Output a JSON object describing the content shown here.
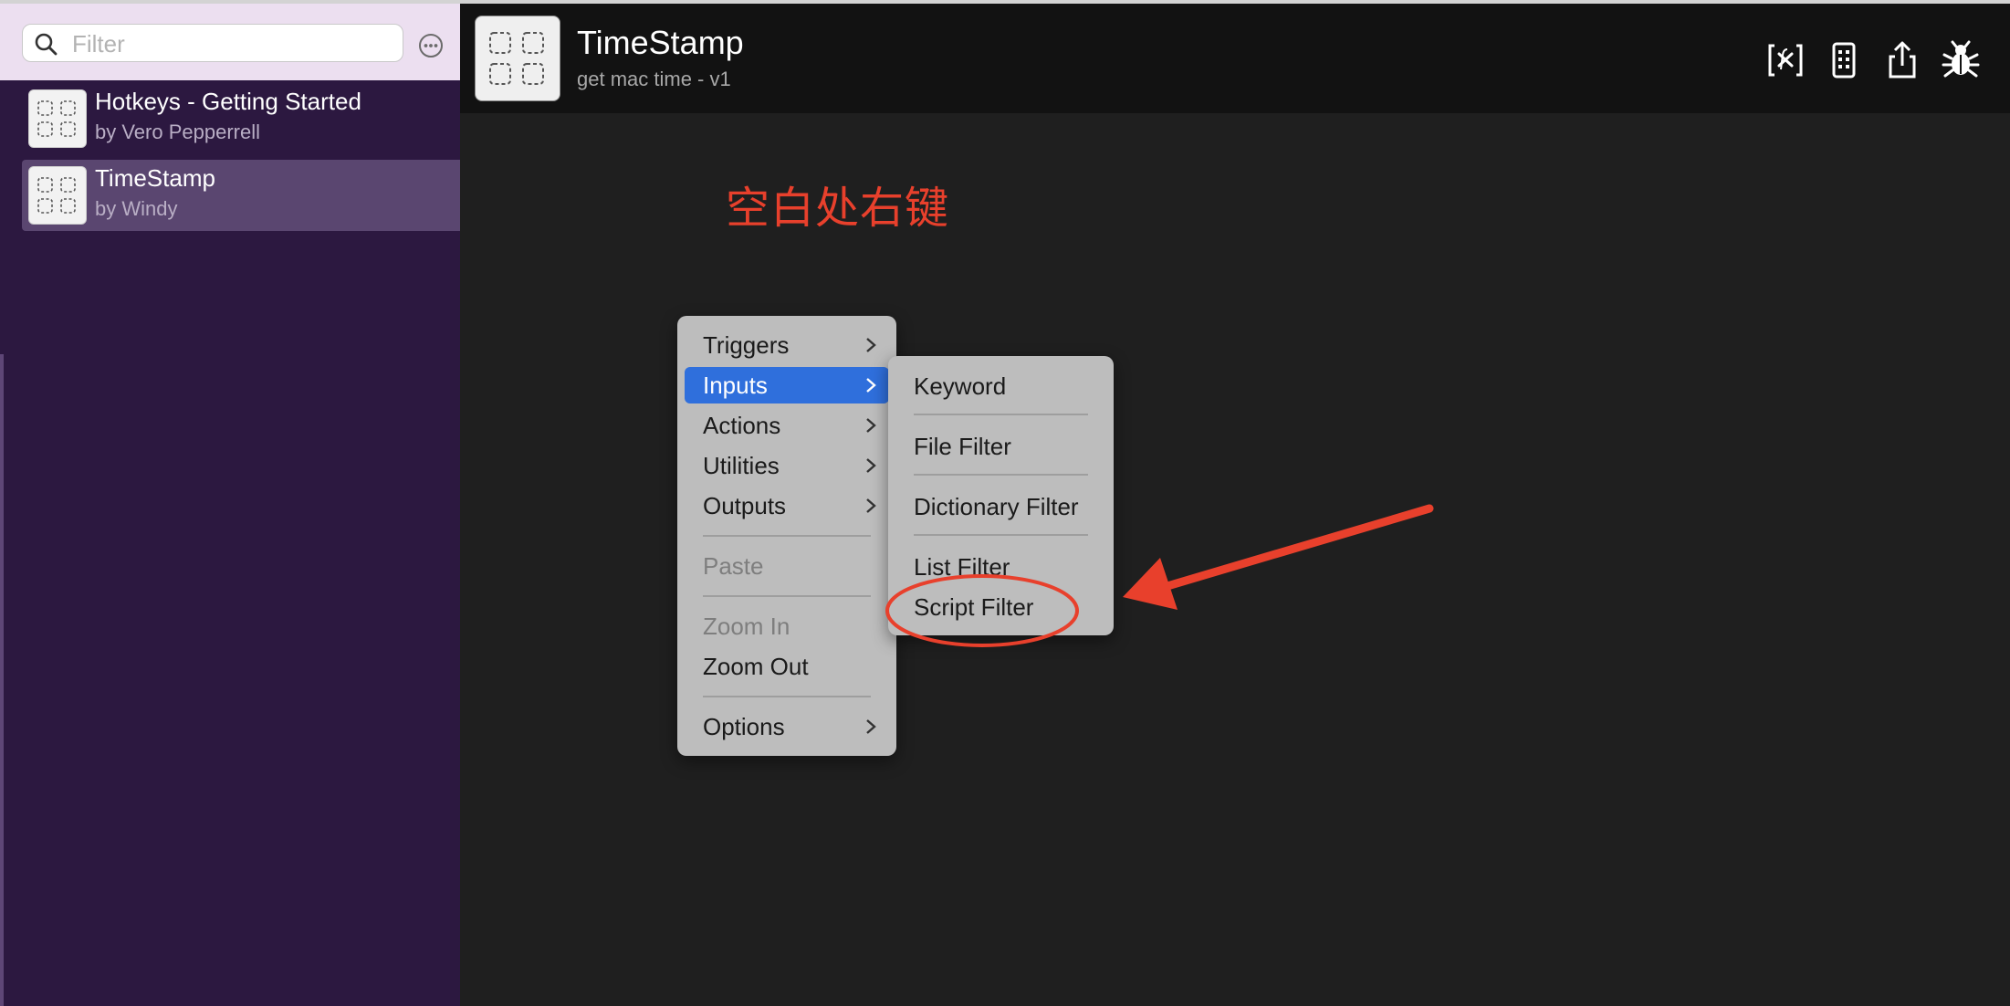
{
  "sidebar": {
    "search": {
      "placeholder": "Filter",
      "value": ""
    },
    "more_icon": "ellipsis-circle-icon",
    "workflows": [
      {
        "title": "Hotkeys - Getting Started",
        "author": "by Vero Pepperrell",
        "selected": false
      },
      {
        "title": "TimeStamp",
        "author": "by Windy",
        "selected": true
      }
    ]
  },
  "header": {
    "title": "TimeStamp",
    "subtitle": "get mac time - v1",
    "toolbar": [
      "variables-icon",
      "notes-icon",
      "share-icon",
      "debug-bug-icon"
    ]
  },
  "annotation": {
    "text": "空白处右键",
    "color": "#e8402c"
  },
  "context_menu": {
    "items": [
      {
        "label": "Triggers",
        "submenu": true
      },
      {
        "label": "Inputs",
        "submenu": true,
        "active": true
      },
      {
        "label": "Actions",
        "submenu": true
      },
      {
        "label": "Utilities",
        "submenu": true
      },
      {
        "label": "Outputs",
        "submenu": true
      },
      {
        "label": "Paste",
        "disabled": true
      },
      {
        "label": "Zoom In",
        "disabled": true
      },
      {
        "label": "Zoom Out"
      },
      {
        "label": "Options",
        "submenu": true
      }
    ],
    "highlight_color": "#2f6fdc"
  },
  "submenu": {
    "items": [
      {
        "label": "Keyword"
      },
      {
        "label": "File Filter"
      },
      {
        "label": "Dictionary Filter"
      },
      {
        "label": "List Filter"
      },
      {
        "label": "Script Filter",
        "circled": true
      }
    ]
  }
}
